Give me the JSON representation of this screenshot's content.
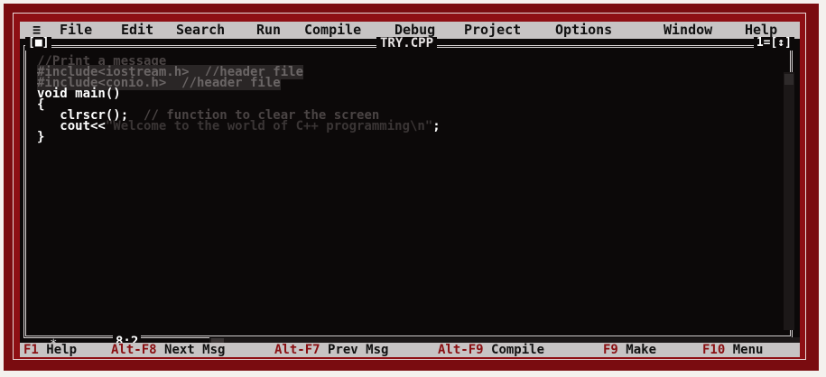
{
  "menu": {
    "system_icon": "≡",
    "items": [
      "File",
      "Edit",
      "Search",
      "Run",
      "Compile",
      "Debug",
      "Project",
      "Options",
      "Window",
      "Help"
    ]
  },
  "window": {
    "close_box": "[■]",
    "title": "TRY.CPP",
    "controls": "1=[↕]",
    "cursor_position": "8:2"
  },
  "code": {
    "line1": "//Print a message",
    "line2": "#include<iostream.h>  //header file",
    "line3": "#include<conio.h>  //header file",
    "line4": "void main()",
    "line5": "{",
    "line6_code": "   clrscr();",
    "line6_comment": "  // function to clear the screen",
    "line7_code": "   cout<<",
    "line7_string": "\"Welcome to the world of C++ programming\\n\"",
    "line7_end": ";",
    "line8": "}"
  },
  "status": {
    "items": [
      {
        "key": "F1",
        "label": "Help"
      },
      {
        "key": "Alt-F8",
        "label": "Next Msg"
      },
      {
        "key": "Alt-F7",
        "label": "Prev Msg"
      },
      {
        "key": "Alt-F9",
        "label": "Compile"
      },
      {
        "key": "F9",
        "label": "Make"
      },
      {
        "key": "F10",
        "label": "Menu"
      }
    ]
  },
  "colors": {
    "frame": "#8e0f14",
    "menu_bg": "#c7c4c4",
    "editor_bg": "#0c0909",
    "hotkey": "#8a0f12"
  }
}
